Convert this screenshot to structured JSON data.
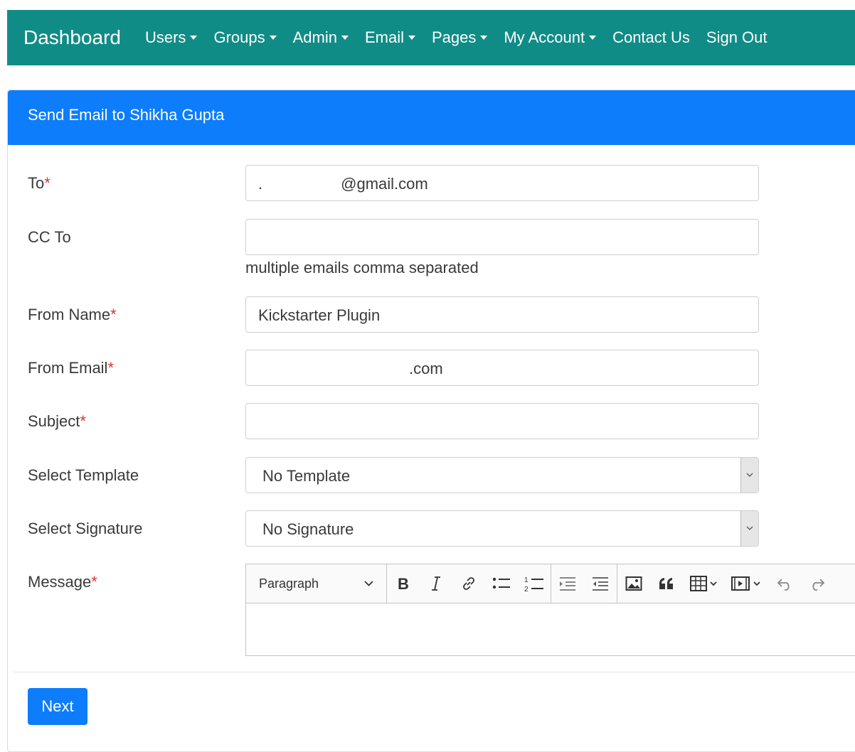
{
  "nav": {
    "brand": "Dashboard",
    "items": [
      {
        "label": "Users",
        "dropdown": true
      },
      {
        "label": "Groups",
        "dropdown": true
      },
      {
        "label": "Admin",
        "dropdown": true
      },
      {
        "label": "Email",
        "dropdown": true
      },
      {
        "label": "Pages",
        "dropdown": true
      },
      {
        "label": "My Account",
        "dropdown": true
      },
      {
        "label": "Contact Us",
        "dropdown": false
      },
      {
        "label": "Sign Out",
        "dropdown": false
      }
    ]
  },
  "card": {
    "title": "Send Email to Shikha Gupta"
  },
  "form": {
    "to": {
      "label": "To",
      "value_prefix": ".",
      "value_suffix": "@gmail.com"
    },
    "cc": {
      "label": "CC To",
      "value": "",
      "help": "multiple emails comma separated"
    },
    "from_name": {
      "label": "From Name",
      "value": "Kickstarter Plugin"
    },
    "from_email": {
      "label": "From Email",
      "value": ".com"
    },
    "subject": {
      "label": "Subject",
      "value": ""
    },
    "template": {
      "label": "Select Template",
      "selected": "No Template"
    },
    "signature": {
      "label": "Select Signature",
      "selected": "No Signature"
    },
    "message": {
      "label": "Message"
    },
    "required_mark": "*"
  },
  "editor": {
    "heading_select": "Paragraph",
    "buttons": [
      "bold-icon",
      "italic-icon",
      "link-icon",
      "bulleted-list-icon",
      "numbered-list-icon",
      "outdent-icon",
      "indent-icon",
      "image-icon",
      "quote-icon",
      "table-icon",
      "media-icon",
      "undo-icon",
      "redo-icon"
    ]
  },
  "actions": {
    "next_label": "Next"
  },
  "colors": {
    "navbar": "#108c87",
    "header": "#0d7dfc",
    "button": "#0d7dfc",
    "required": "#d63333"
  }
}
